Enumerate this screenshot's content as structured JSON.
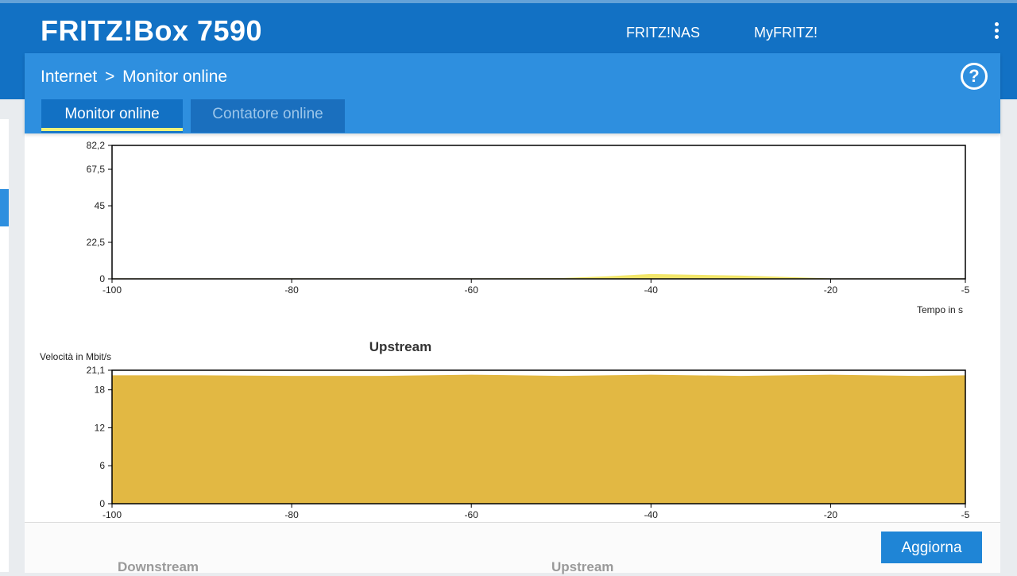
{
  "app": {
    "brand": "FRITZ!Box 7590",
    "nav_links": [
      "FRITZ!NAS",
      "MyFRITZ!"
    ],
    "menu_icon": "more-vertical-icon"
  },
  "breadcrumb": {
    "section": "Internet",
    "separator": ">",
    "page": "Monitor online"
  },
  "help_icon": "question-circle-icon",
  "help_label": "?",
  "tabs": [
    {
      "label": "Monitor online",
      "active": true
    },
    {
      "label": "Contatore online",
      "active": false
    }
  ],
  "colors": {
    "brand_blue": "#1271c4",
    "sub_blue": "#2e8fdf",
    "downstream_fill": "#f2e66a",
    "upstream_fill": "#e2b843",
    "tab_underline": "#eef27a"
  },
  "chart_data": [
    {
      "type": "area",
      "title": "",
      "ylabel": "Velocità in Mbit/s",
      "xlabel": "Tempo in s",
      "ylim": [
        0,
        82.2
      ],
      "xlim": [
        -100,
        -5
      ],
      "yticks": [
        "0",
        "22,5",
        "45",
        "67,5",
        "82,2"
      ],
      "xticks": [
        "-100",
        "-80",
        "-60",
        "-40",
        "-20",
        "-5"
      ],
      "series": [
        {
          "x": [
            -100,
            -60,
            -50,
            -45,
            -40,
            -30,
            -20,
            -5
          ],
          "values": [
            0.3,
            0.3,
            0.5,
            1.5,
            3.0,
            2.0,
            0.3,
            0.3
          ]
        }
      ]
    },
    {
      "type": "area",
      "title": "Upstream",
      "ylabel": "Velocità in Mbit/s",
      "xlabel": "",
      "ylim": [
        0,
        21.1
      ],
      "xlim": [
        -100,
        -5
      ],
      "yticks": [
        "0",
        "6",
        "12",
        "18",
        "21,1"
      ],
      "xticks": [
        "-100",
        "-80",
        "-60",
        "-40",
        "-20",
        "-5"
      ],
      "series": [
        {
          "x": [
            -100,
            -90,
            -80,
            -70,
            -60,
            -50,
            -40,
            -30,
            -20,
            -10,
            -5
          ],
          "values": [
            20.3,
            20.3,
            20.2,
            20.2,
            20.4,
            20.2,
            20.4,
            20.2,
            20.4,
            20.2,
            20.3
          ]
        }
      ]
    }
  ],
  "actions": {
    "refresh_label": "Aggiorna"
  },
  "footer_labels": {
    "downstream": "Downstream",
    "upstream": "Upstream"
  }
}
